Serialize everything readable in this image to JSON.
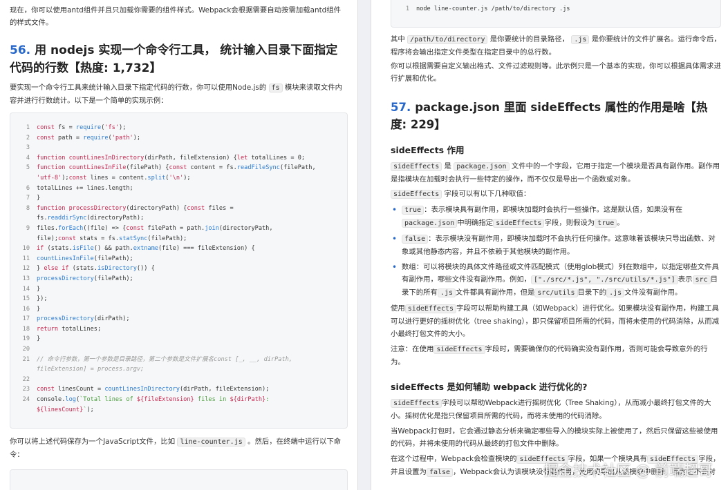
{
  "left": {
    "intro": "现在，你可以使用antd组件并且只加载你需要的组件样式。Webpack会根据需要自动按需加载antd组件的样式文件。",
    "q56": {
      "num": "56.",
      "title": "用 nodejs 实现一个命令行工具， 统计输入目录下面指定代码的行数【热度: 1,732】",
      "p1a": "要实现一个命令行工具来统计输入目录下指定代码的行数，你可以使用Node.js的",
      "p1code": "fs",
      "p1b": "模块来读取文件内容并进行行数统计。以下是一个简单的实现示例：",
      "code": [
        "const fs = require('fs');",
        "const path = require('path');",
        "",
        "function countLinesInDirectory(dirPath, fileExtension) {let totalLines = 0;",
        "function countLinesInFile(filePath) {const content = fs.readFileSync(filePath,",
        "'utf-8');const lines = content.split('\\n');",
        "    totalLines += lines.length;",
        "  }",
        "function processDirectory(directoryPath) {const files =",
        "fs.readdirSync(directoryPath);",
        "    files.forEach((file) => {const filePath = path.join(directoryPath,",
        "file);const stats = fs.statSync(filePath);",
        "if (stats.isFile() && path.extname(file) === fileExtension) {",
        "        countLinesInFile(filePath);",
        "      } else if (stats.isDirectory()) {",
        "        processDirectory(filePath);",
        "      }",
        "    });",
        "  }",
        "  processDirectory(dirPath);",
        "return totalLines;",
        "}",
        "",
        "// 命令行参数，第一个参数是目录路径，第二个参数是文件扩展名const [_, __, dirPath,",
        "fileExtension] = process.argv;",
        "",
        "const linesCount = countLinesInDirectory(dirPath, fileExtension);",
        "console.log(`Total lines of ${fileExtension} files in ${dirPath}:",
        "${linesCount}`);"
      ],
      "p2a": "你可以将上述代码保存为一个JavaScript文件，比如",
      "p2code": "line-counter.js",
      "p2b": "。然后，在终端中运行以下命令："
    }
  },
  "right": {
    "cmd_line_no": "1",
    "cmd": "node line-counter.js /path/to/directory .js",
    "p1a": "其中",
    "p1c1": "/path/to/directory",
    "p1b": "是你要统计的目录路径，",
    "p1c2": ".js",
    "p1d": "是你要统计的文件扩展名。运行命令后，程序将会输出指定文件类型在指定目录中的总行数。",
    "p2": "你可以根据需要自定义输出格式、文件过滤规则等。此示例只是一个基本的实现，你可以根据具体需求进行扩展和优化。",
    "q57": {
      "num": "57.",
      "title": "package.json 里面 sideEffects 属性的作用是啥【热度: 229】",
      "h_a": "sideEffects 作用",
      "pa_c1": "sideEffects",
      "pa_t1": "是",
      "pa_c2": "package.json",
      "pa_t2": "文件中的一个字段，它用于指定一个模块是否具有副作用。副作用是指模块在加载时会执行一些特定的操作，而不仅仅是导出一个函数或对象。",
      "pb_c": "sideEffects",
      "pb_t": "字段可以有以下几种取值：",
      "li1_c1": "true",
      "li1_t1": "：表示模块具有副作用，即模块加载时会执行一些操作。这是默认值，如果没有在",
      "li1_c2": "package.json",
      "li1_t2": "中明确指定",
      "li1_c3": "sideEffects",
      "li1_t3": "字段，则假设为",
      "li1_c4": "true",
      "li1_t4": "。",
      "li2_c1": "false",
      "li2_t1": "：表示模块没有副作用，即模块加载时不会执行任何操作。这意味着该模块只导出函数、对象或其他静态内容，并且不依赖于其他模块的副作用。",
      "li3_t1": "数组：可以将模块的具体文件路径或文件匹配模式（使用glob模式）列在数组中，以指定哪些文件具有副作用，哪些文件没有副作用。例如，",
      "li3_c1": "[\"./src/*.js\", \"./src/utils/*.js\"]",
      "li3_t2": "表示",
      "li3_c2": "src",
      "li3_t3": "目录下的所有",
      "li3_c3": ".js",
      "li3_t4": "文件都具有副作用，但是",
      "li3_c4": "src/utils",
      "li3_t5": "目录下的",
      "li3_c5": ".js",
      "li3_t6": "文件没有副作用。",
      "pc_t1": "使用",
      "pc_c": "sideEffects",
      "pc_t2": "字段可以帮助构建工具（如Webpack）进行优化。如果模块没有副作用，构建工具可以进行更好的摇树优化（tree shaking），即只保留项目所需的代码，而将未使用的代码消除，从而减小最终打包文件的大小。",
      "pd_t1": "注意：在使用",
      "pd_c": "sideEffects",
      "pd_t2": "字段时，需要确保你的代码确实没有副作用，否则可能会导致意外的行为。",
      "h_b": "sideEffects 是如何辅助 webpack 进行优化的?",
      "pe_c": "sideEffects",
      "pe_t": "字段可以帮助Webpack进行摇树优化（Tree Shaking），从而减小最终打包文件的大小。摇树优化是指只保留项目所需的代码，而将未使用的代码消除。",
      "pf": "当Webpack打包时，它会通过静态分析来确定哪些导入的模块实际上被使用了，然后只保留这些被使用的代码，并将未使用的代码从最终的打包文件中删除。",
      "pg_t1": "在这个过程中，Webpack会检查模块的",
      "pg_c1": "sideEffects",
      "pg_t2": "字段。如果一个模块具有",
      "pg_c2": "sideEffects",
      "pg_t3": "字段，并且设置为",
      "pg_c3": "false",
      "pg_t4": "，Webpack会认为该模块没有副作用，",
      "pg_t5": "使用的导出从该模块中删除，因为它不会对"
    },
    "watermark": "掘金技术社区 @ 前端超哥"
  }
}
